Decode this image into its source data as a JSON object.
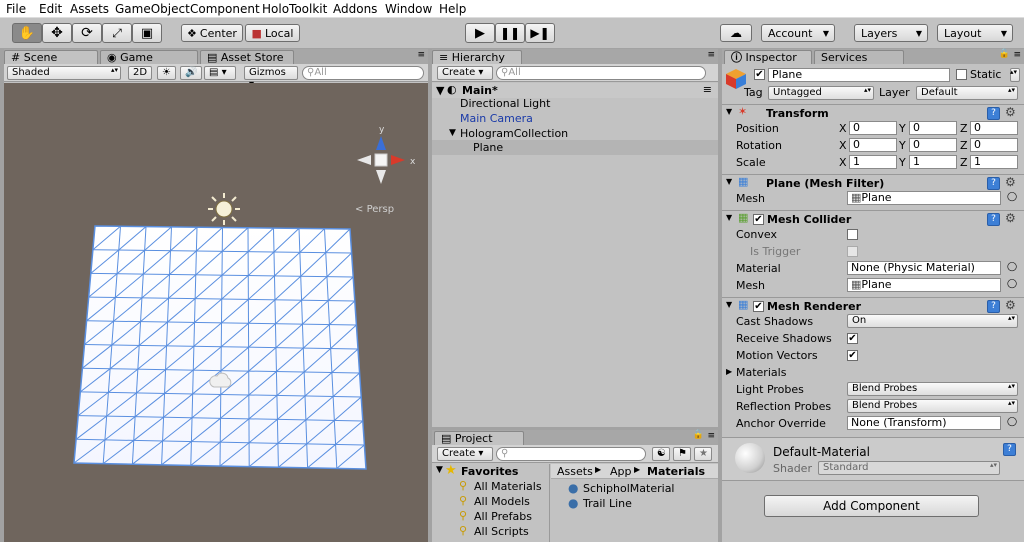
{
  "menu": [
    "File",
    "Edit",
    "Assets",
    "GameObject",
    "Component",
    "HoloToolkit",
    "Addons",
    "Window",
    "Help"
  ],
  "toolbar": {
    "center": "Center",
    "local": "Local",
    "account": "Account",
    "layers": "Layers",
    "layout": "Layout"
  },
  "scene": {
    "tabs": [
      "Scene",
      "Game",
      "Asset Store"
    ],
    "shading": "Shaded",
    "mode2d": "2D",
    "gizmos": "Gizmos",
    "search": "All",
    "persp": "Persp",
    "axis_x": "x",
    "axis_y": "y"
  },
  "hierarchy": {
    "tab": "Hierarchy",
    "create": "Create",
    "search": "All",
    "scene": "Main*",
    "items": [
      "Directional Light",
      "Main Camera",
      "HologramCollection",
      "Plane"
    ]
  },
  "project": {
    "tab": "Project",
    "create": "Create",
    "favorites": "Favorites",
    "fav_items": [
      "All Materials",
      "All Models",
      "All Prefabs",
      "All Scripts"
    ],
    "breadcrumb": [
      "Assets",
      "App",
      "Materials"
    ],
    "assets": [
      "SchipholMaterial",
      "Trail Line"
    ]
  },
  "inspector": {
    "tabs": [
      "Inspector",
      "Services"
    ],
    "name": "Plane",
    "static_label": "Static",
    "tag_label": "Tag",
    "tag": "Untagged",
    "layer_label": "Layer",
    "layer": "Default",
    "transform": {
      "title": "Transform",
      "rows": [
        {
          "label": "Position",
          "x": "0",
          "y": "0",
          "z": "0"
        },
        {
          "label": "Rotation",
          "x": "0",
          "y": "0",
          "z": "0"
        },
        {
          "label": "Scale",
          "x": "1",
          "y": "1",
          "z": "1"
        }
      ]
    },
    "mesh_filter": {
      "title": "Plane (Mesh Filter)",
      "mesh_label": "Mesh",
      "mesh": "Plane"
    },
    "mesh_collider": {
      "title": "Mesh Collider",
      "convex": "Convex",
      "is_trigger": "Is Trigger",
      "material_label": "Material",
      "material": "None (Physic Material)",
      "mesh_label": "Mesh",
      "mesh": "Plane"
    },
    "mesh_renderer": {
      "title": "Mesh Renderer",
      "cast_shadows_label": "Cast Shadows",
      "cast_shadows": "On",
      "receive_shadows": "Receive Shadows",
      "motion_vectors": "Motion Vectors",
      "materials": "Materials",
      "light_probes_label": "Light Probes",
      "light_probes": "Blend Probes",
      "reflection_probes_label": "Reflection Probes",
      "reflection_probes": "Blend Probes",
      "anchor_label": "Anchor Override",
      "anchor": "None (Transform)"
    },
    "material": {
      "name": "Default-Material",
      "shader_label": "Shader",
      "shader": "Standard"
    },
    "add_component": "Add Component"
  },
  "colors": {
    "scene_bg": "#6f655d",
    "grid": "#5a8fe0",
    "selection": "#b4b4b4"
  }
}
